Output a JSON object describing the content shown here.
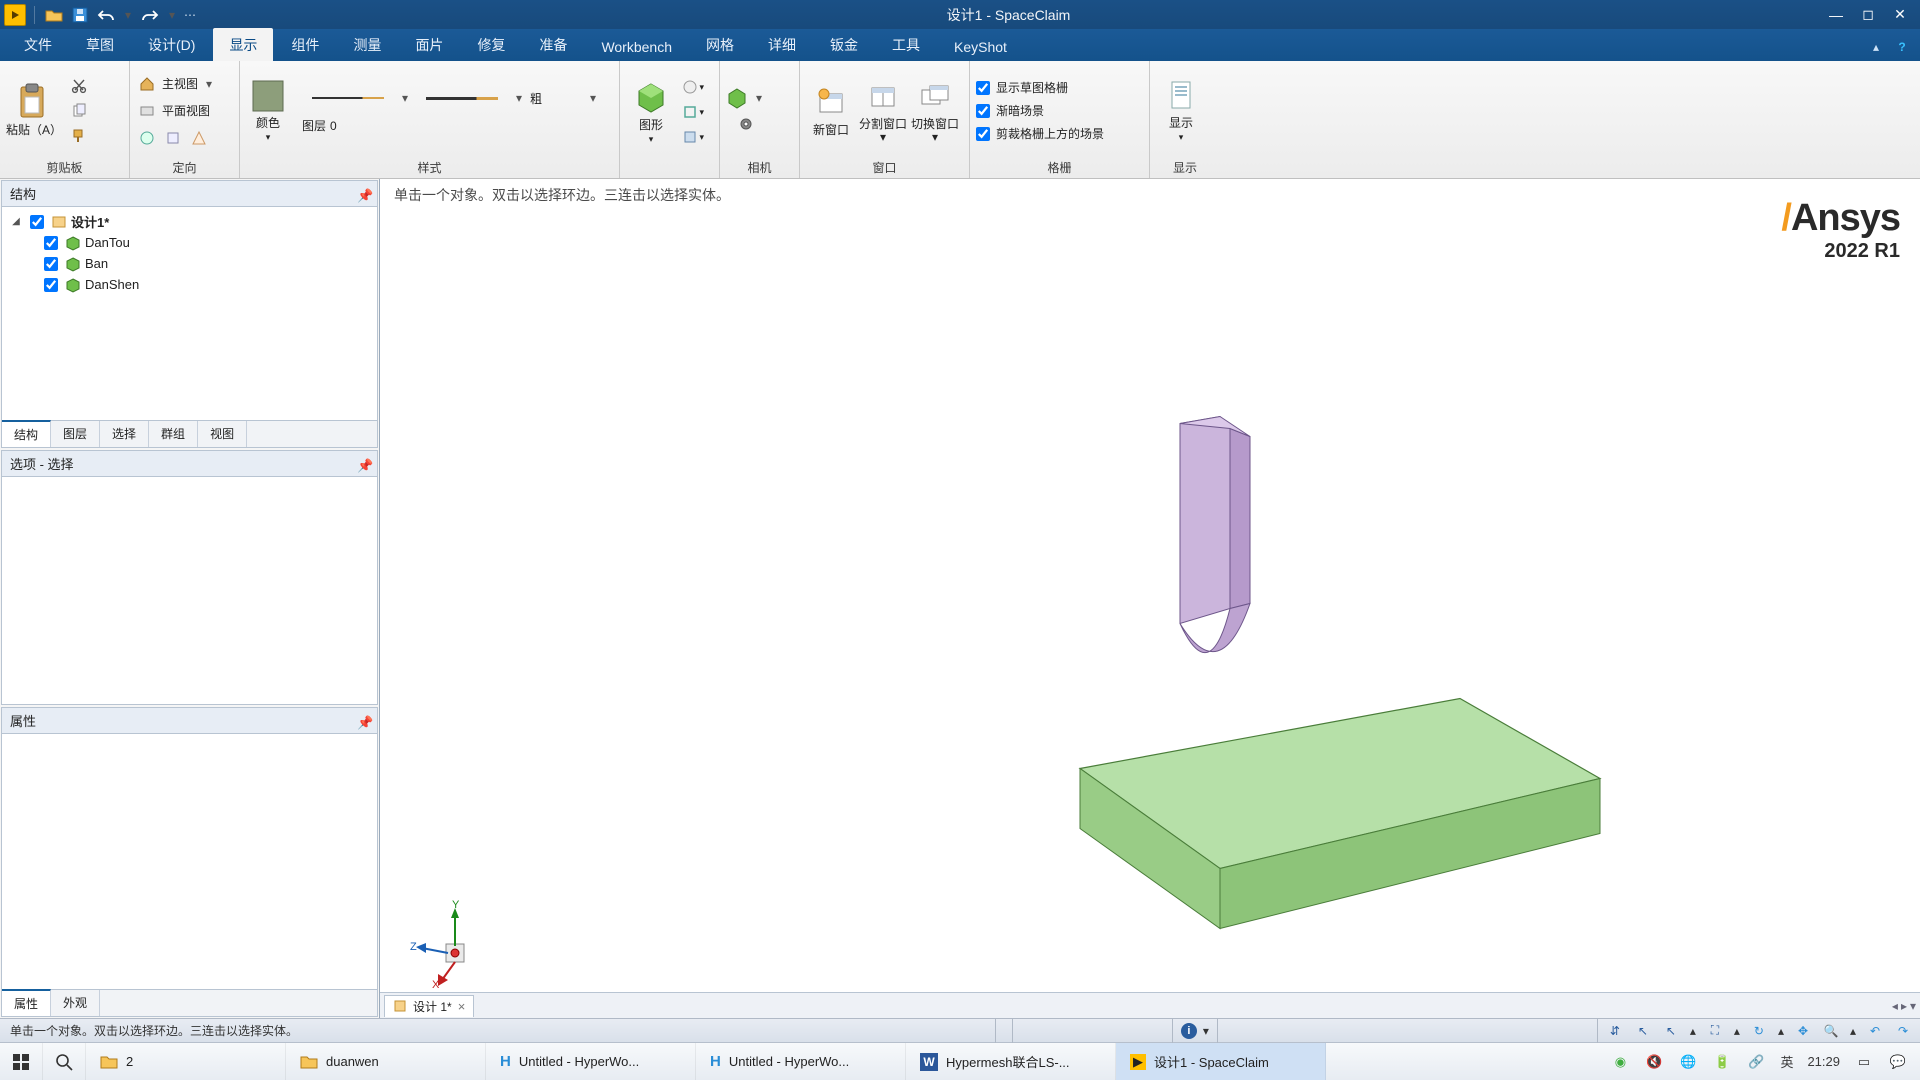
{
  "colors": {
    "accent": "#15609e",
    "titlebar": "#184a7c"
  },
  "qat": {
    "undo": "撤销",
    "redo": "重做"
  },
  "title": "设计1 - SpaceClaim",
  "tabs": {
    "items": [
      "文件",
      "草图",
      "设计(D)",
      "显示",
      "组件",
      "测量",
      "面片",
      "修复",
      "准备",
      "Workbench",
      "网格",
      "详细",
      "钣金",
      "工具",
      "KeyShot"
    ],
    "active": 3
  },
  "ribbon": {
    "clipboard": {
      "paste": "粘贴（A）",
      "label": "剪贴板"
    },
    "orient": {
      "home": "主视图",
      "plan": "平面视图",
      "locate": "定向"
    },
    "color": {
      "label": "颜色",
      "group": "样式"
    },
    "layer": {
      "prefix": "图层",
      "value": "0"
    },
    "weight": {
      "label": "粗"
    },
    "graphics": {
      "label": "图形"
    },
    "camera": {
      "label": "相机"
    },
    "windows": {
      "new": "新窗口",
      "split": "分割窗口",
      "switch": "切换窗口",
      "group": "窗口"
    },
    "grid": {
      "chk1": "显示草图格栅",
      "chk2": "渐暗场景",
      "chk3": "剪裁格栅上方的场景",
      "group": "格栅"
    },
    "show": {
      "btn": "显示",
      "group": "显示"
    }
  },
  "panels": {
    "structure": {
      "title": "结构",
      "subtabs": [
        "结构",
        "图层",
        "选择",
        "群组",
        "视图"
      ],
      "subActive": 0
    },
    "options": {
      "title": "选项 - 选择"
    },
    "props": {
      "title": "属性",
      "subtabs": [
        "属性",
        "外观"
      ],
      "subActive": 0
    }
  },
  "tree": {
    "root": "设计1*",
    "children": [
      {
        "name": "DanTou"
      },
      {
        "name": "Ban"
      },
      {
        "name": "DanShen"
      }
    ]
  },
  "viewport": {
    "hint": "单击一个对象。双击以选择环边。三连击以选择实体。",
    "brand": "Ansys",
    "version": "2022 R1",
    "axes": {
      "x": "X",
      "y": "Y",
      "z": "Z"
    }
  },
  "doctab": {
    "label": "设计 1*"
  },
  "status": {
    "msg": "单击一个对象。双击以选择环边。三连击以选择实体。"
  },
  "taskbar": {
    "items": [
      {
        "label": "2",
        "kind": "folder"
      },
      {
        "label": "duanwen",
        "kind": "folder"
      },
      {
        "label": "Untitled - HyperWo...",
        "kind": "hw"
      },
      {
        "label": "Untitled - HyperWo...",
        "kind": "hw"
      },
      {
        "label": "Hypermesh联合LS-...",
        "kind": "word"
      },
      {
        "label": "设计1 - SpaceClaim",
        "kind": "sc",
        "active": true
      }
    ],
    "ime": "英",
    "time": "21:29"
  }
}
